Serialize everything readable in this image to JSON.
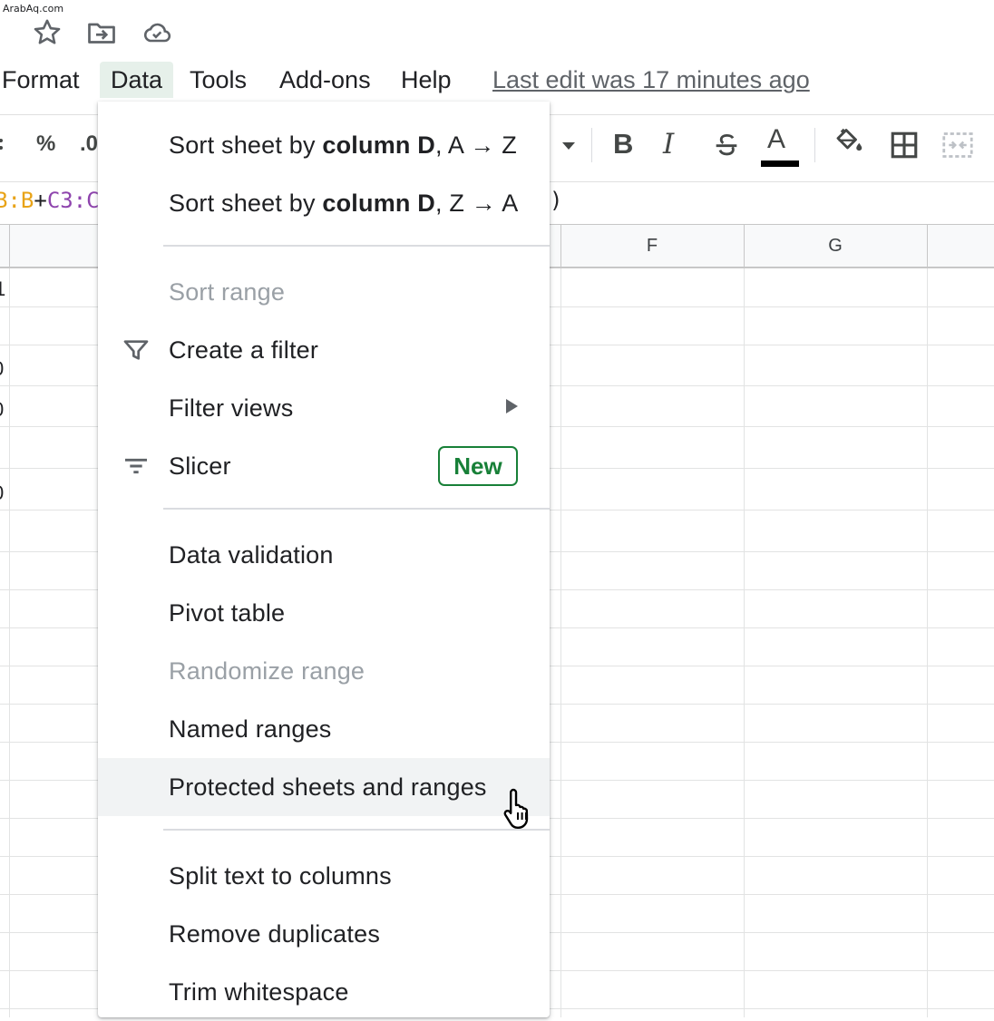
{
  "watermark": "ArabAq.com",
  "top_icons": [
    "star-icon",
    "move-to-folder-icon",
    "cloud-saved-icon"
  ],
  "menubar": {
    "items": [
      {
        "label": "Format",
        "active": false
      },
      {
        "label": "Data",
        "active": true
      },
      {
        "label": "Tools",
        "active": false
      },
      {
        "label": "Add-ons",
        "active": false
      },
      {
        "label": "Help",
        "active": false
      }
    ],
    "last_edit": "Last edit was 17 minutes ago"
  },
  "toolbar": {
    "percent": "%",
    "decimal_partial": ".0",
    "bold": "B",
    "italic": "I",
    "text_color_letter": "A",
    "icons": [
      "dropdown-arrow-icon",
      "bold-icon",
      "italic-icon",
      "strikethrough-icon",
      "text-color-icon",
      "fill-color-icon",
      "borders-icon",
      "merge-cells-icon"
    ],
    "text_color_hex": "#000000"
  },
  "formula_bar": {
    "part1": "B:B",
    "plus": "+",
    "part2": "C3:C",
    "closing": ")",
    "part1_color": "#e8a317",
    "part2_color": "#8e44ad"
  },
  "grid": {
    "col_headers": [
      "F",
      "G"
    ],
    "partial_cell_values": [
      "1",
      "0",
      "0",
      "0"
    ]
  },
  "menu": {
    "sort_asc": {
      "prefix": "Sort sheet by ",
      "bold": "column D",
      "suffix": ", A → Z"
    },
    "sort_desc": {
      "prefix": "Sort sheet by ",
      "bold": "column D",
      "suffix": ", Z → A"
    },
    "sort_range": "Sort range",
    "create_filter": "Create a filter",
    "filter_views": "Filter views",
    "slicer": "Slicer",
    "slicer_badge": "New",
    "data_validation": "Data validation",
    "pivot_table": "Pivot table",
    "randomize_range": "Randomize range",
    "named_ranges": "Named ranges",
    "protected_sheets": "Protected sheets and ranges",
    "split_text": "Split text to columns",
    "remove_duplicates": "Remove duplicates",
    "trim_whitespace": "Trim whitespace",
    "badge_color": "#188038",
    "hover_bg": "#f1f3f4"
  }
}
